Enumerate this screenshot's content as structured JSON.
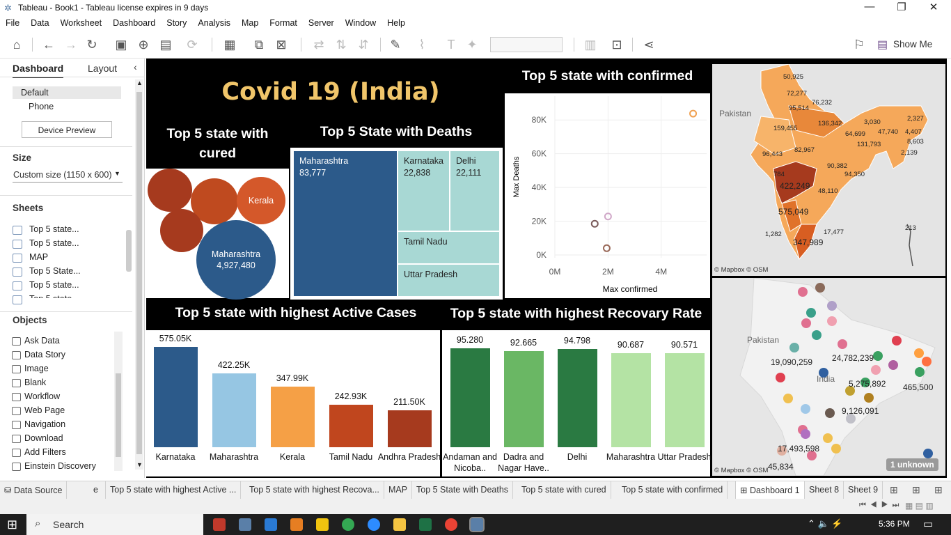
{
  "window": {
    "title": "Tableau - Book1 - Tableau license expires in 9 days"
  },
  "menu": [
    "File",
    "Data",
    "Worksheet",
    "Dashboard",
    "Story",
    "Analysis",
    "Map",
    "Format",
    "Server",
    "Window",
    "Help"
  ],
  "toolbar": {
    "show_me": "Show Me"
  },
  "left": {
    "tabs": {
      "dashboard": "Dashboard",
      "layout": "Layout"
    },
    "device": {
      "default": "Default",
      "phone": "Phone",
      "preview": "Device Preview"
    },
    "size": {
      "label": "Size",
      "value": "Custom size (1150 x 600)"
    },
    "sheets": {
      "label": "Sheets",
      "items": [
        "Top 5 state...",
        "Top 5 state...",
        "MAP",
        "Top 5 State...",
        "Top 5 state...",
        "Top 5 state..."
      ]
    },
    "objects": {
      "label": "Objects",
      "items": [
        "Ask Data",
        "Data Story",
        "Image",
        "Blank",
        "Workflow",
        "Web Page",
        "Navigation",
        "Download",
        "Add Filters",
        "Einstein Discovery"
      ]
    }
  },
  "dashboard": {
    "title": "Covid 19 (India)",
    "cured": {
      "title": "Top 5 state with cured",
      "labels": {
        "kerala": "Kerala",
        "maharashtra": "Maharashtra",
        "maharashtra_val": "4,927,480"
      }
    },
    "deaths": {
      "title": "Top 5 State with Deaths",
      "tiles": [
        {
          "name": "Maharashtra",
          "value": "83,777"
        },
        {
          "name": "Karnataka",
          "value": "22,838"
        },
        {
          "name": "Delhi",
          "value": "22,111"
        },
        {
          "name": "Tamil Nadu",
          "value": ""
        },
        {
          "name": "Uttar Pradesh",
          "value": ""
        }
      ]
    },
    "confirmed": {
      "title": "Top 5 state with confirmed",
      "xlabel": "Max confirmed",
      "ylabel": "Max Deaths",
      "yticks": [
        "80K",
        "60K",
        "40K",
        "20K",
        "0K"
      ],
      "xticks": [
        "0M",
        "2M",
        "4M"
      ]
    },
    "map": {
      "credit": "© Mapbox © OSM",
      "country": "Pakistan",
      "values": [
        "50,925",
        "72,277",
        "95,514",
        "76,232",
        "159,455",
        "136,342",
        "3,030",
        "2,327",
        "47,740",
        "4,407",
        "64,699",
        "8,603",
        "131,793",
        "2,139",
        "96,443",
        "82,967",
        "90,382",
        "94,350",
        "784",
        "422,249",
        "48,110",
        "575,049",
        "17,477",
        "1,282",
        "347,989",
        "213"
      ]
    },
    "active": {
      "title": "Top 5 state with highest Active Cases"
    },
    "recovery": {
      "title": "Top 5 state with highest Recovary Rate"
    },
    "map2": {
      "credit": "© Mapbox © OSM",
      "country": "Pakistan",
      "india": "India",
      "unknown": "1 unknown",
      "values": [
        "19,090,259",
        "24,782,239",
        "5,275,892",
        "465,500",
        "9,126,091",
        "17,493,598",
        "45,834"
      ]
    }
  },
  "chart_data": [
    {
      "type": "bar",
      "title": "Top 5 state with highest Active Cases",
      "categories": [
        "Karnataka",
        "Maharashtra",
        "Kerala",
        "Tamil Nadu",
        "Andhra Pradesh"
      ],
      "values": [
        575050,
        422250,
        347990,
        242930,
        211500
      ],
      "labels": [
        "575.05K",
        "422.25K",
        "347.99K",
        "242.93K",
        "211.50K"
      ],
      "colors": [
        "#2c5a8a",
        "#96c6e3",
        "#f5a046",
        "#c0461e",
        "#a63a1e"
      ]
    },
    {
      "type": "bar",
      "title": "Top 5 state with highest Recovary Rate",
      "categories": [
        "Andaman and Nicoba..",
        "Dadra and Nagar Have..",
        "Delhi",
        "Maharashtra",
        "Uttar Pradesh"
      ],
      "values": [
        95.28,
        92.665,
        94.798,
        90.687,
        90.571
      ],
      "labels": [
        "95.280",
        "92.665",
        "94.798",
        "90.687",
        "90.571"
      ],
      "colors": [
        "#2a7a42",
        "#6ab764",
        "#2a7a42",
        "#b4e3a4",
        "#b4e3a4"
      ]
    },
    {
      "type": "scatter",
      "title": "Top 5 state with confirmed",
      "xlabel": "Max confirmed",
      "ylabel": "Max Deaths",
      "points": [
        {
          "x": 5200000,
          "y": 83777
        },
        {
          "x": 1500000,
          "y": 18500
        },
        {
          "x": 2000000,
          "y": 22800
        },
        {
          "x": 1950000,
          "y": 4000
        }
      ]
    }
  ],
  "tabs": [
    "Data Source",
    "Top 5 state with highest Active ...",
    "Top 5 state with highest Recova...",
    "MAP",
    "Top 5 State with Deaths",
    "Top 5 state with  cured",
    "Top 5 state with confirmed",
    "Dashboard 1",
    "Sheet 8",
    "Sheet 9"
  ],
  "taskbar": {
    "search": "Search",
    "time": "5:36 PM"
  }
}
